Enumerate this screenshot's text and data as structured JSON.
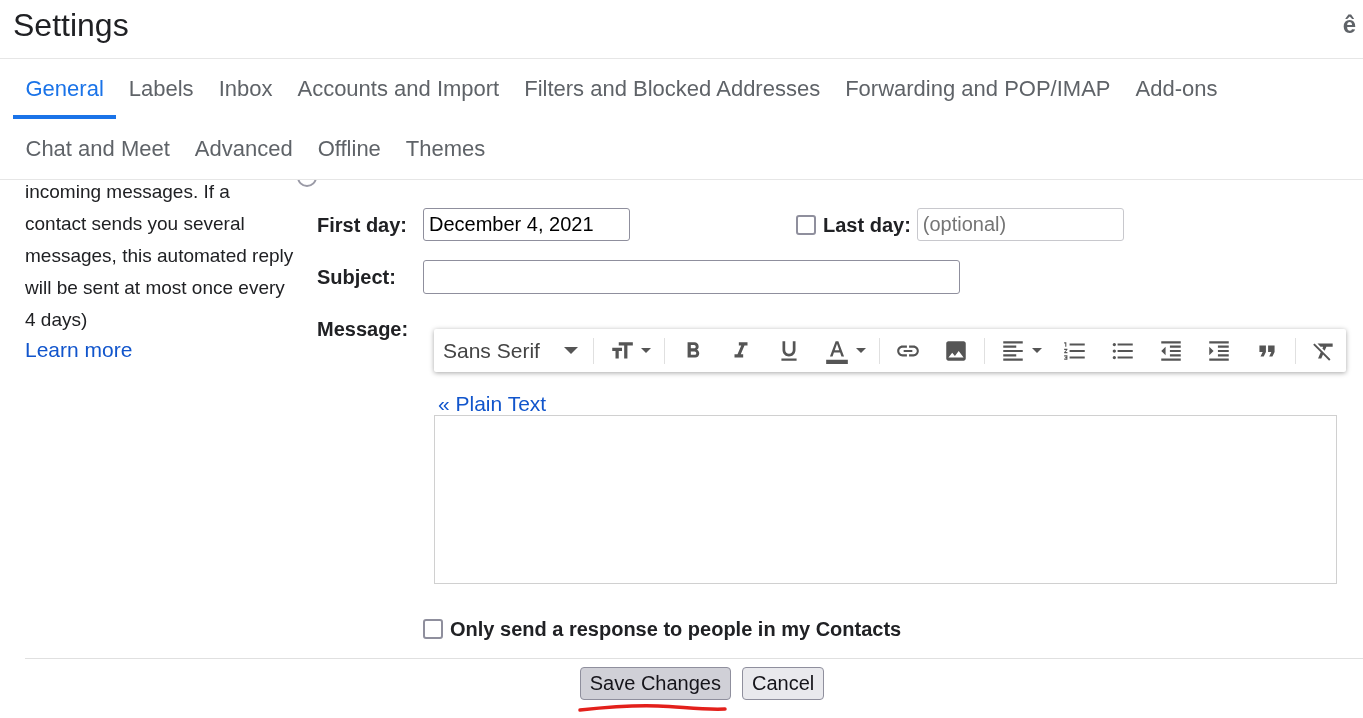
{
  "header": {
    "title": "Settings",
    "input_tools_glyph": "ê"
  },
  "tabs": [
    {
      "label": "General",
      "selected": true
    },
    {
      "label": "Labels",
      "selected": false
    },
    {
      "label": "Inbox",
      "selected": false
    },
    {
      "label": "Accounts and Import",
      "selected": false
    },
    {
      "label": "Filters and Blocked Addresses",
      "selected": false
    },
    {
      "label": "Forwarding and POP/IMAP",
      "selected": false
    },
    {
      "label": "Add-ons",
      "selected": false
    },
    {
      "label": "Chat and Meet",
      "selected": false
    },
    {
      "label": "Advanced",
      "selected": false
    },
    {
      "label": "Offline",
      "selected": false
    },
    {
      "label": "Themes",
      "selected": false
    }
  ],
  "sidebar": {
    "description": "incoming messages. If a contact sends you several messages, this automated reply will be sent at most once every 4 days)",
    "link": "Learn more"
  },
  "vacation_responder": {
    "selected": false
  },
  "form": {
    "first_day": {
      "label": "First day:",
      "value": "December 4, 2021"
    },
    "last_day": {
      "label": "Last day:",
      "checked": false,
      "placeholder": "(optional)"
    },
    "subject": {
      "label": "Subject:"
    },
    "message": {
      "label": "Message:",
      "font": "Sans Serif",
      "plain_text_link": "« Plain Text"
    },
    "contacts_only": {
      "label": "Only send a response to people in my Contacts",
      "checked": false
    }
  },
  "buttons": [
    {
      "label": "Save Changes",
      "hovered": true,
      "underlined": true
    },
    {
      "label": "Cancel",
      "hovered": false,
      "underlined": false
    }
  ]
}
